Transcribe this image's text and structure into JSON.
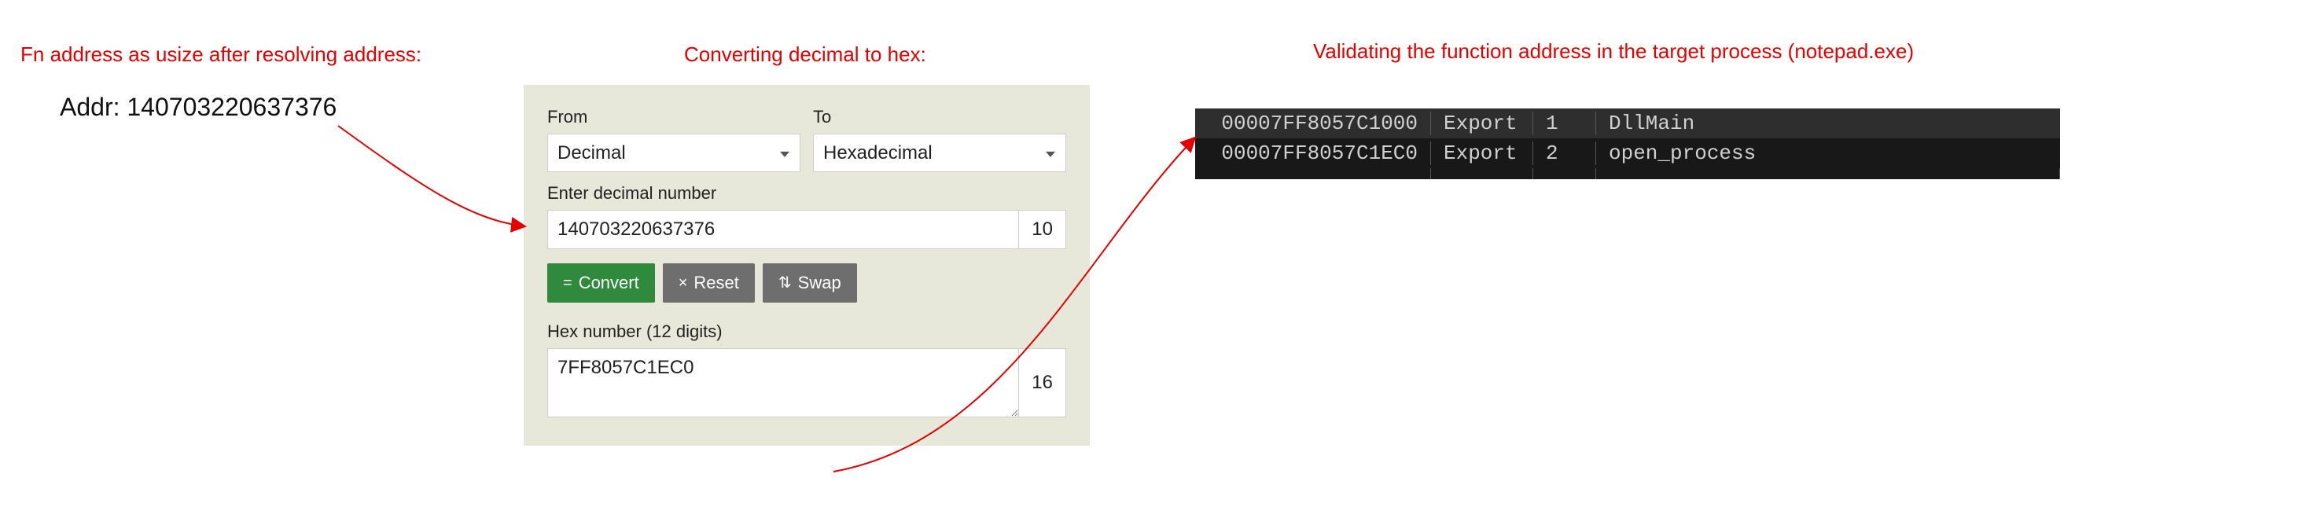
{
  "annotations": {
    "a1": "Fn address as usize after resolving address:",
    "a2": "Converting decimal to hex:",
    "a3": "Validating the function address in the target process (notepad.exe)"
  },
  "addr": {
    "label": "Addr:",
    "value": "140703220637376"
  },
  "converter": {
    "from_label": "From",
    "to_label": "To",
    "from_value": "Decimal",
    "to_value": "Hexadecimal",
    "input_label": "Enter decimal number",
    "input_value": "140703220637376",
    "input_suffix": "10",
    "convert_label": "Convert",
    "reset_label": "Reset",
    "swap_label": "Swap",
    "output_label": "Hex number (12 digits)",
    "output_value": "7FF8057C1EC0",
    "output_suffix": "16"
  },
  "debugger": {
    "rows": [
      {
        "addr": "00007FF8057C1000",
        "kind": "Export",
        "ord": "1",
        "name": "DllMain",
        "highlight": true
      },
      {
        "addr": "00007FF8057C1EC0",
        "kind": "Export",
        "ord": "2",
        "name": "open_process",
        "highlight": false
      }
    ]
  }
}
